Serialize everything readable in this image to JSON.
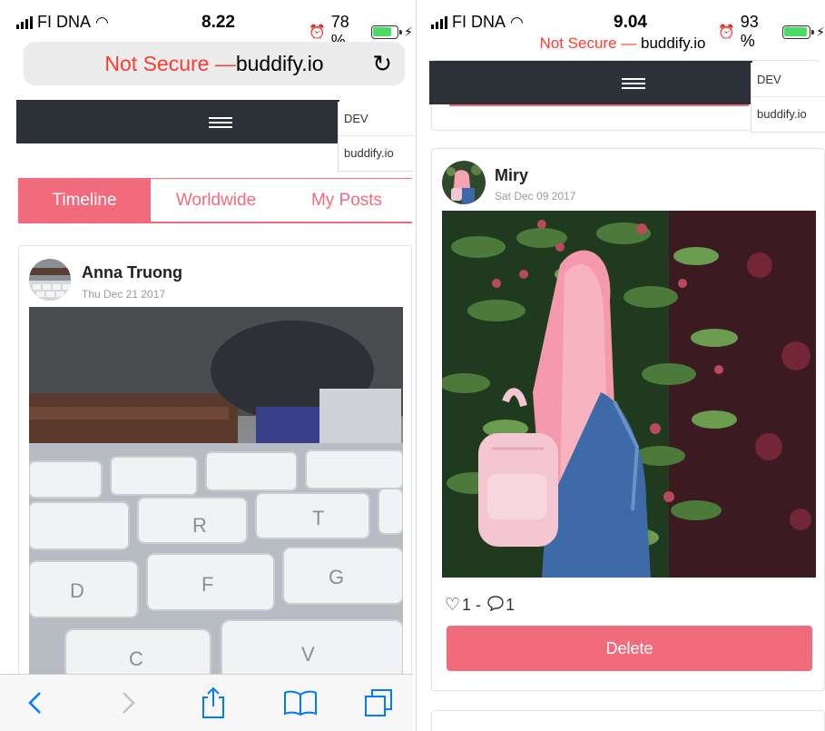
{
  "left": {
    "status": {
      "carrier": "FI DNA",
      "time": "8.22",
      "battery": "78 %",
      "battery_level": 0.78
    },
    "url": {
      "prefix": "Not Secure — ",
      "domain": "buddify.io"
    },
    "nav": {
      "dropdown_items": [
        "DEV",
        "buddify.io"
      ]
    },
    "tabs": [
      {
        "label": "Timeline",
        "active": true
      },
      {
        "label": "Worldwide",
        "active": false
      },
      {
        "label": "My Posts",
        "active": false
      }
    ],
    "post": {
      "author": "Anna Truong",
      "date": "Thu Dec 21 2017"
    }
  },
  "right": {
    "status": {
      "carrier": "FI DNA",
      "time": "9.04",
      "battery": "93 %",
      "battery_level": 0.93
    },
    "url": {
      "prefix": "Not Secure — ",
      "domain": "buddify.io"
    },
    "nav": {
      "dropdown_items": [
        "DEV",
        "buddify.io"
      ]
    },
    "post": {
      "author": "Miry",
      "date": "Sat Dec 09 2017",
      "likes": "1 - ",
      "comments": "1",
      "delete_label": "Delete"
    }
  },
  "colors": {
    "accent": "#f26b7d",
    "nav_dark": "#2c3037",
    "not_secure": "#ff3b30",
    "ios_blue": "#007aff"
  },
  "icons": {
    "toolbar": [
      "back-icon",
      "forward-icon",
      "share-icon",
      "bookmarks-icon",
      "tabs-icon"
    ]
  }
}
